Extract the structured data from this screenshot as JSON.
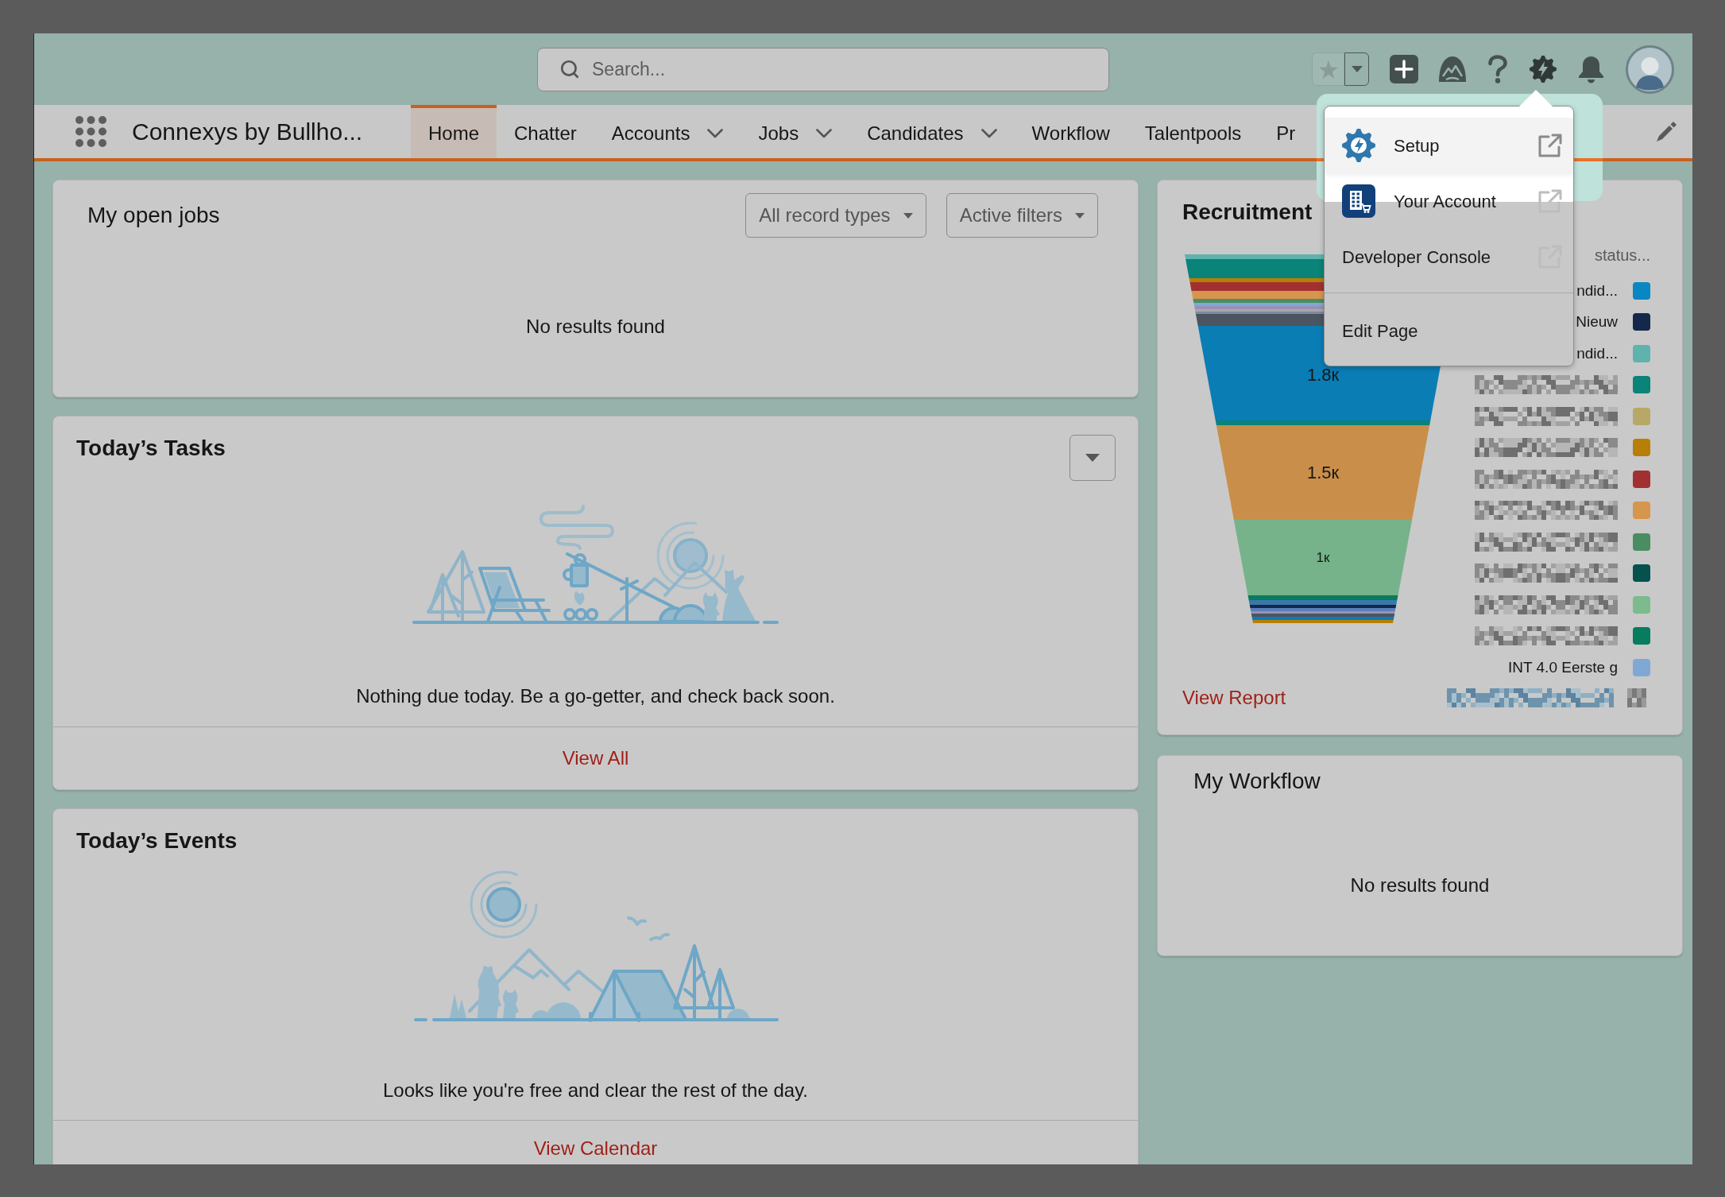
{
  "header": {
    "search": {
      "placeholder": "Search..."
    }
  },
  "nav": {
    "app_name": "Connexys by Bullho...",
    "tabs": [
      {
        "label": "Home",
        "selected": true,
        "has_menu": false
      },
      {
        "label": "Chatter",
        "selected": false,
        "has_menu": false
      },
      {
        "label": "Accounts",
        "selected": false,
        "has_menu": true
      },
      {
        "label": "Jobs",
        "selected": false,
        "has_menu": true
      },
      {
        "label": "Candidates",
        "selected": false,
        "has_menu": true
      },
      {
        "label": "Workflow",
        "selected": false,
        "has_menu": false
      },
      {
        "label": "Talentpools",
        "selected": false,
        "has_menu": false
      },
      {
        "label": "Pr",
        "selected": false,
        "has_menu": false
      }
    ]
  },
  "my_open_jobs": {
    "title": "My open jobs",
    "filters": [
      "All record types",
      "Active filters"
    ],
    "empty_message": "No results found"
  },
  "todays_tasks": {
    "title": "Today’s Tasks",
    "message": "Nothing due today. Be a go-getter, and check back soon.",
    "footer_link": "View All"
  },
  "todays_events": {
    "title": "Today’s Events",
    "message": "Looks like you're free and clear the rest of the day.",
    "footer_link": "View Calendar"
  },
  "recruitment": {
    "title": "Recruitment",
    "funnel_labels": [
      "1.8к",
      "1.5к",
      "1к"
    ],
    "legend_title": "status...",
    "legend": [
      {
        "kind": "label",
        "label": "ndid...",
        "color": "#0a86c2"
      },
      {
        "kind": "label",
        "label": "Nieuw",
        "color": "#14284b"
      },
      {
        "kind": "label",
        "label": "ndid...",
        "color": "#5fb3ad"
      },
      {
        "kind": "blurred",
        "color": "#0a8379"
      },
      {
        "kind": "blurred",
        "color": "#b8a867"
      },
      {
        "kind": "blurred",
        "color": "#b77f07"
      },
      {
        "kind": "blurred",
        "color": "#a33030"
      },
      {
        "kind": "blurred",
        "color": "#d6964e"
      },
      {
        "kind": "blurred",
        "color": "#4b8d63"
      },
      {
        "kind": "blurred",
        "color": "#04514e"
      },
      {
        "kind": "blurred",
        "color": "#7bbb8d"
      },
      {
        "kind": "blurred",
        "color": "#077c5e"
      },
      {
        "kind": "label",
        "label": "INT 4.0 Eerste g",
        "color": "#7fa9d4"
      }
    ],
    "footer_link": "View Report"
  },
  "my_workflow": {
    "title": "My Workflow",
    "empty_message": "No results found"
  },
  "setup_menu": {
    "items": [
      {
        "label": "Setup",
        "kind": "gear",
        "external": true,
        "highlighted": true,
        "divider_before": false
      },
      {
        "label": "Your Account",
        "kind": "account",
        "external": true,
        "highlighted": false,
        "divider_before": false
      },
      {
        "label": "Developer Console",
        "kind": "plain",
        "external": true,
        "highlighted": false,
        "divider_before": false
      },
      {
        "label": "Edit Page",
        "kind": "plain",
        "external": false,
        "highlighted": false,
        "divider_before": true
      }
    ]
  }
}
